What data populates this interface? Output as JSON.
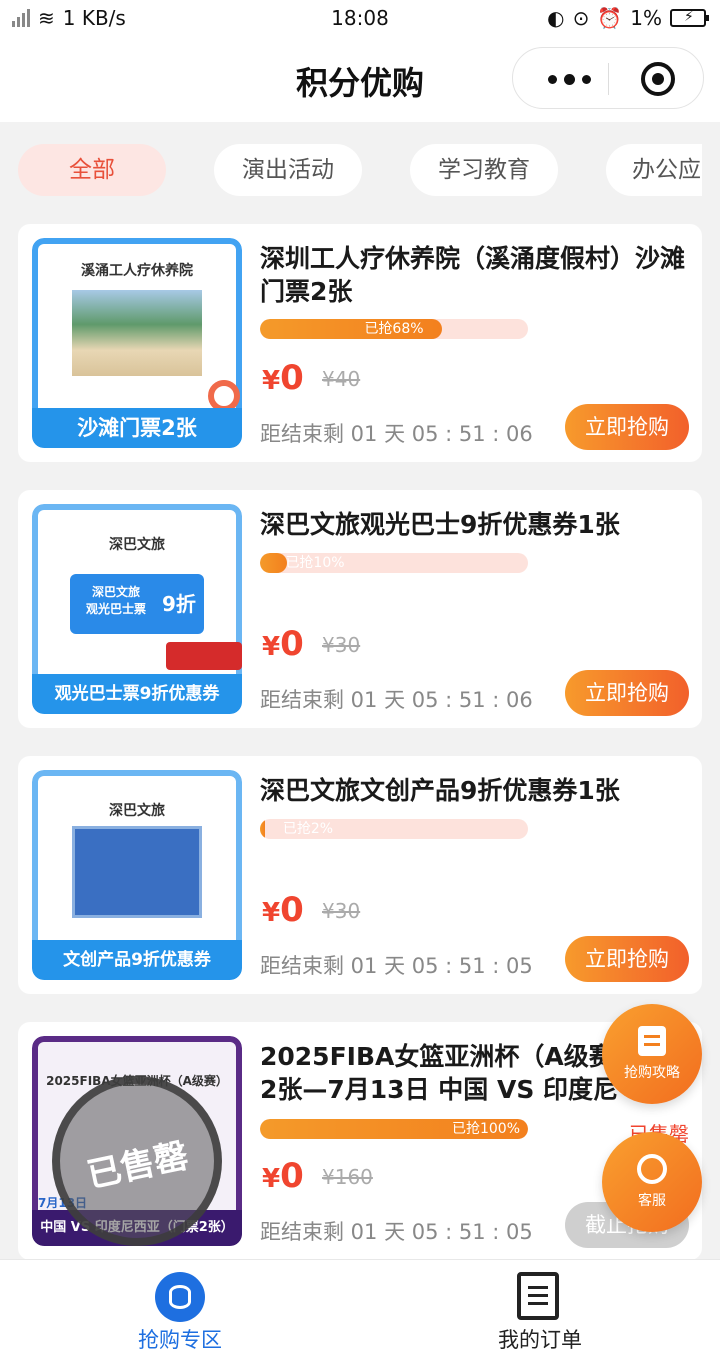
{
  "status_bar": {
    "net": "1 KB/s",
    "time": "18:08",
    "battery": "1%"
  },
  "nav": {
    "title": "积分优购"
  },
  "tabs": [
    "全部",
    "演出活动",
    "学习教育",
    "办公应"
  ],
  "cards": [
    {
      "thumb_heading": "溪涌工人疗休养院",
      "thumb_caption": "沙滩门票2张",
      "title": "深圳工人疗休养院（溪涌度假村）沙滩门票2张",
      "progress_text": "已抢68%",
      "progress": 0.68,
      "price": "0",
      "currency": "¥",
      "original_price": "¥40",
      "countdown": "距结束剩 01 天 05 : 51 : 06",
      "button": "立即抢购"
    },
    {
      "thumb_heading": "深巴文旅",
      "thumb_ticket": "深巴文旅\n观光巴士票",
      "thumb_discount": "9折",
      "thumb_caption": "观光巴士票9折优惠券",
      "title": "深巴文旅观光巴士9折优惠券1张",
      "progress_text": "已抢10%",
      "progress": 0.1,
      "price": "0",
      "currency": "¥",
      "original_price": "¥30",
      "countdown": "距结束剩 01 天 05 : 51 : 06",
      "button": "立即抢购"
    },
    {
      "thumb_heading": "深巴文旅",
      "thumb_caption": "文创产品9折优惠券",
      "title": "深巴文旅文创产品9折优惠券1张",
      "progress_text": "已抢2%",
      "progress": 0.02,
      "price": "0",
      "currency": "¥",
      "original_price": "¥30",
      "countdown": "距结束剩 01 天 05 : 51 : 05",
      "button": "立即抢购"
    },
    {
      "thumb_heading": "2025FIBA女篮亚洲杯（A级赛）",
      "thumb_date": "7月13日",
      "thumb_caption": "中国 VS 印度尼西亚（门票2张）",
      "stamp": "已售罄",
      "title": "2025FIBA女篮亚洲杯（A级赛）门票2张—7月13日 中国 VS 印度尼",
      "progress_text": "已抢100%",
      "progress": 1.0,
      "sold_out": "已售罄",
      "price": "0",
      "currency": "¥",
      "original_price": "¥160",
      "countdown": "距结束剩 01 天 05 : 51 : 05",
      "button": "截止抢购"
    }
  ],
  "floats": {
    "guide": "抢购攻略",
    "service": "客服"
  },
  "bottom_nav": [
    {
      "label": "抢购专区",
      "color": "#1e6fe0"
    },
    {
      "label": "我的订单",
      "color": "#222222"
    }
  ],
  "colors": {
    "accent": "#f0452f",
    "button": "#f3801e",
    "tab_active_bg": "#fde6e3"
  }
}
